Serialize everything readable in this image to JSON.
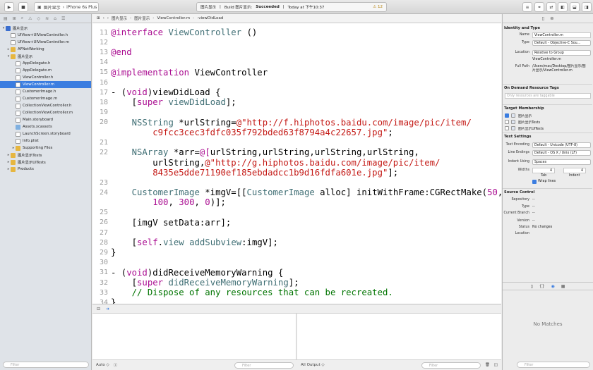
{
  "toolbar": {
    "scheme": "图片显示",
    "device": "iPhone 6s Plus",
    "status": {
      "target": "图片显示",
      "build_prefix": "Build 图片显示:",
      "build_result": "Succeeded",
      "time": "Today at 下午10:37",
      "warnings": "12"
    }
  },
  "navigator": {
    "filter_placeholder": "Filter",
    "items": [
      {
        "label": "图片显示",
        "level": 0,
        "kind": "proj",
        "disclosure": "▾"
      },
      {
        "label": "UIView+UIViewController.h",
        "level": 1,
        "kind": "file"
      },
      {
        "label": "UIView+UIViewController.m",
        "level": 1,
        "kind": "file"
      },
      {
        "label": "AFNetWorking",
        "level": 1,
        "kind": "folder",
        "disclosure": "▸"
      },
      {
        "label": "图片显示",
        "level": 1,
        "kind": "folder",
        "disclosure": "▾"
      },
      {
        "label": "AppDelegate.h",
        "level": 2,
        "kind": "file"
      },
      {
        "label": "AppDelegate.m",
        "level": 2,
        "kind": "file"
      },
      {
        "label": "ViewController.h",
        "level": 2,
        "kind": "file"
      },
      {
        "label": "ViewController.m",
        "level": 2,
        "kind": "file",
        "selected": true
      },
      {
        "label": "CustomerImage.h",
        "level": 2,
        "kind": "file"
      },
      {
        "label": "CustomerImage.m",
        "level": 2,
        "kind": "file"
      },
      {
        "label": "CollectionViewController.h",
        "level": 2,
        "kind": "file"
      },
      {
        "label": "CollectionViewController.m",
        "level": 2,
        "kind": "file"
      },
      {
        "label": "Main.storyboard",
        "level": 2,
        "kind": "file"
      },
      {
        "label": "Assets.xcassets",
        "level": 2,
        "kind": "assets"
      },
      {
        "label": "LaunchScreen.storyboard",
        "level": 2,
        "kind": "file"
      },
      {
        "label": "Info.plist",
        "level": 2,
        "kind": "file"
      },
      {
        "label": "Supporting Files",
        "level": 2,
        "kind": "folder",
        "disclosure": "▸"
      },
      {
        "label": "图片显示Tests",
        "level": 1,
        "kind": "folder",
        "disclosure": "▸"
      },
      {
        "label": "图片显示UITests",
        "level": 1,
        "kind": "folder",
        "disclosure": "▸"
      },
      {
        "label": "Products",
        "level": 1,
        "kind": "folder",
        "disclosure": "▸"
      }
    ]
  },
  "jumpbar": {
    "crumbs": [
      "图片显示",
      "图片显示",
      "ViewController.m",
      "-viewDidLoad"
    ]
  },
  "editor": {
    "lines": [
      {
        "n": "11",
        "tokens": [
          {
            "t": "@interface ",
            "c": "kw"
          },
          {
            "t": "ViewController",
            "c": "cls"
          },
          {
            "t": " ()",
            "c": ""
          }
        ]
      },
      {
        "n": "12",
        "tokens": []
      },
      {
        "n": "13",
        "tokens": [
          {
            "t": "@end",
            "c": "kw"
          }
        ]
      },
      {
        "n": "14",
        "tokens": []
      },
      {
        "n": "15",
        "tokens": [
          {
            "t": "@implementation ",
            "c": "kw"
          },
          {
            "t": "ViewController",
            "c": ""
          }
        ]
      },
      {
        "n": "16",
        "tokens": []
      },
      {
        "n": "17",
        "tokens": [
          {
            "t": "- (",
            "c": ""
          },
          {
            "t": "void",
            "c": "kw"
          },
          {
            "t": ")viewDidLoad {",
            "c": ""
          }
        ]
      },
      {
        "n": "18",
        "tokens": [
          {
            "t": "    [",
            "c": ""
          },
          {
            "t": "super",
            "c": "kw"
          },
          {
            "t": " ",
            "c": ""
          },
          {
            "t": "viewDidLoad",
            "c": "cls"
          },
          {
            "t": "];",
            "c": ""
          }
        ]
      },
      {
        "n": "19",
        "tokens": []
      },
      {
        "n": "20",
        "tokens": [
          {
            "t": "    ",
            "c": ""
          },
          {
            "t": "NSString",
            "c": "cls"
          },
          {
            "t": " *urlString=",
            "c": ""
          },
          {
            "t": "@\"http://f.hiphotos.baidu.com/image/pic/item/",
            "c": "str"
          }
        ]
      },
      {
        "n": "",
        "tokens": [
          {
            "t": "        c9fcc3cec3fdfc035f792bded63f8794a4c22657.jpg\"",
            "c": "str"
          },
          {
            "t": ";",
            "c": ""
          }
        ]
      },
      {
        "n": "21",
        "tokens": []
      },
      {
        "n": "22",
        "tokens": [
          {
            "t": "    ",
            "c": ""
          },
          {
            "t": "NSArray",
            "c": "cls"
          },
          {
            "t": " *arr=",
            "c": ""
          },
          {
            "t": "@[",
            "c": "kw"
          },
          {
            "t": "urlString,urlString,urlString,urlString,",
            "c": ""
          }
        ]
      },
      {
        "n": "",
        "tokens": [
          {
            "t": "        urlString,",
            "c": ""
          },
          {
            "t": "@\"http://g.hiphotos.baidu.com/image/pic/item/",
            "c": "str"
          }
        ]
      },
      {
        "n": "",
        "tokens": [
          {
            "t": "        8435e5dde71190ef185ebdadcc1b9d16fdfa601e.jpg\"",
            "c": "str"
          },
          {
            "t": "];",
            "c": ""
          }
        ]
      },
      {
        "n": "23",
        "tokens": []
      },
      {
        "n": "24",
        "tokens": [
          {
            "t": "    ",
            "c": ""
          },
          {
            "t": "CustomerImage",
            "c": "cls"
          },
          {
            "t": " *imgV=[[",
            "c": ""
          },
          {
            "t": "CustomerImage",
            "c": "cls"
          },
          {
            "t": " alloc] initWithFrame:CGRectMake(",
            "c": ""
          },
          {
            "t": "50",
            "c": "kw"
          },
          {
            "t": ",",
            "c": ""
          }
        ]
      },
      {
        "n": "",
        "tokens": [
          {
            "t": "        ",
            "c": ""
          },
          {
            "t": "100",
            "c": "kw"
          },
          {
            "t": ", ",
            "c": ""
          },
          {
            "t": "300",
            "c": "kw"
          },
          {
            "t": ", ",
            "c": ""
          },
          {
            "t": "0",
            "c": "kw"
          },
          {
            "t": ")];",
            "c": ""
          }
        ]
      },
      {
        "n": "25",
        "tokens": []
      },
      {
        "n": "26",
        "tokens": [
          {
            "t": "    [imgV setData:arr];",
            "c": ""
          }
        ]
      },
      {
        "n": "27",
        "tokens": []
      },
      {
        "n": "28",
        "tokens": [
          {
            "t": "    [",
            "c": ""
          },
          {
            "t": "self",
            "c": "kw"
          },
          {
            "t": ".",
            "c": ""
          },
          {
            "t": "view",
            "c": "cls"
          },
          {
            "t": " ",
            "c": ""
          },
          {
            "t": "addSubview",
            "c": "cls"
          },
          {
            "t": ":imgV];",
            "c": ""
          }
        ]
      },
      {
        "n": "29",
        "tokens": [
          {
            "t": "}",
            "c": ""
          }
        ]
      },
      {
        "n": "30",
        "tokens": []
      },
      {
        "n": "31",
        "tokens": [
          {
            "t": "- (",
            "c": ""
          },
          {
            "t": "void",
            "c": "kw"
          },
          {
            "t": ")didReceiveMemoryWarning {",
            "c": ""
          }
        ]
      },
      {
        "n": "32",
        "tokens": [
          {
            "t": "    [",
            "c": ""
          },
          {
            "t": "super",
            "c": "kw"
          },
          {
            "t": " ",
            "c": ""
          },
          {
            "t": "didReceiveMemoryWarning",
            "c": "cls"
          },
          {
            "t": "];",
            "c": ""
          }
        ]
      },
      {
        "n": "33",
        "tokens": [
          {
            "t": "    // Dispose of any resources that can be recreated.",
            "c": "cmt"
          }
        ]
      },
      {
        "n": "34",
        "tokens": [
          {
            "t": "}",
            "c": ""
          }
        ]
      }
    ]
  },
  "debug": {
    "auto_label": "Auto ◇",
    "filter_placeholder": "Filter",
    "output_label": "All Output ◇",
    "right_filter_placeholder": "Filter"
  },
  "inspector": {
    "identity_title": "Identity and Type",
    "name_label": "Name",
    "name_value": "ViewController.m",
    "type_label": "Type",
    "type_value": "Default - Objective-C Sou...",
    "location_label": "Location",
    "location_value": "Relative to Group",
    "location_file": "ViewController.m",
    "fullpath_label": "Full Path",
    "fullpath_value": "/Users/mac/Desktop/图片显示/图片显示/ViewController.m",
    "odr_title": "On Demand Resource Tags",
    "odr_placeholder": "Only resources are taggable",
    "membership_title": "Target Membership",
    "targets": [
      {
        "label": "图片显示",
        "checked": true
      },
      {
        "label": "图片显示Tests",
        "checked": false
      },
      {
        "label": "图片显示UITests",
        "checked": false
      }
    ],
    "text_title": "Text Settings",
    "encoding_label": "Text Encoding",
    "encoding_value": "Default - Unicode (UTF-8)",
    "endings_label": "Line Endings",
    "endings_value": "Default - OS X / Unix (LF)",
    "indent_label": "Indent Using",
    "indent_value": "Spaces",
    "widths_label": "Widths",
    "tab_value": "4",
    "indent_width_value": "4",
    "tab_label": "Tab",
    "indent_sub_label": "Indent",
    "wrap_label": "Wrap lines",
    "source_title": "Source Control",
    "repository_label": "Repository",
    "repository_value": "--",
    "sc_type_label": "Type",
    "sc_type_value": "--",
    "branch_label": "Current Branch",
    "branch_value": "--",
    "version_label": "Version",
    "version_value": "--",
    "status_label": "Status",
    "status_value": "No changes",
    "sc_location_label": "Location",
    "no_matches": "No Matches",
    "filter_placeholder": "Filter"
  }
}
